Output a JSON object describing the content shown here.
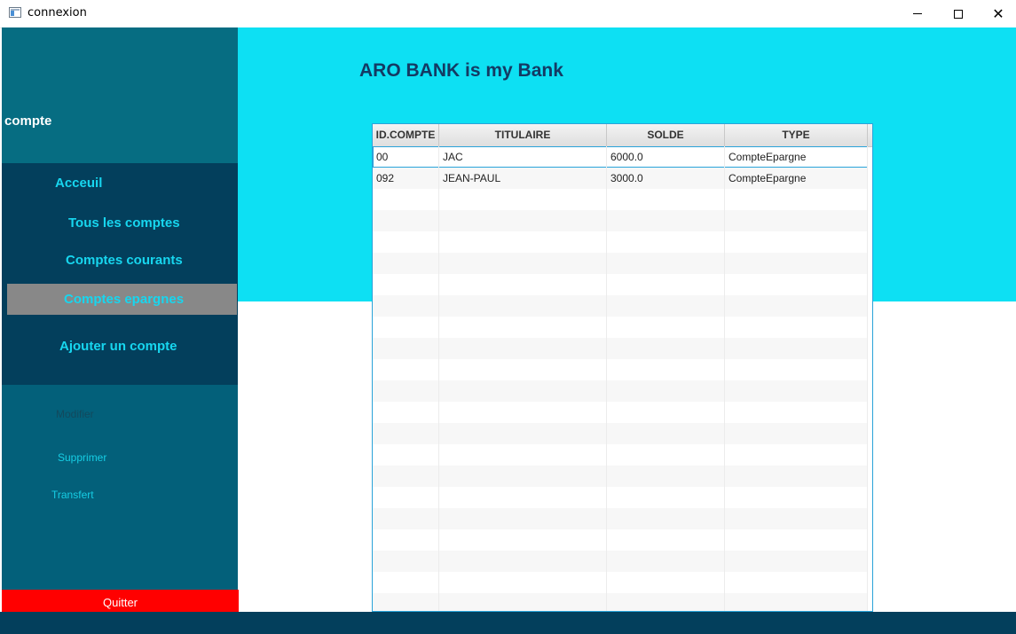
{
  "window": {
    "title": "connexion",
    "minimize_icon": "minimize-icon",
    "maximize_icon": "maximize-icon",
    "close_icon": "close-icon",
    "close_glyph": "✕"
  },
  "sidebar": {
    "heading": "compte",
    "nav": {
      "accueil": "Acceuil",
      "tous": "Tous les comptes",
      "courants": "Comptes courants",
      "epargnes": "Comptes epargnes",
      "ajouter": "Ajouter un compte"
    },
    "actions": {
      "modifier": "Modifier",
      "supprimer": "Supprimer",
      "transfert": "Transfert"
    },
    "quit": "Quitter"
  },
  "main": {
    "title": "ARO BANK is my Bank"
  },
  "table": {
    "columns": [
      "ID.COMPTE",
      "TITULAIRE",
      "SOLDE",
      "TYPE"
    ],
    "rows": [
      [
        "00",
        "JAC",
        "6000.0",
        "CompteEpargne"
      ],
      [
        "092",
        "JEAN-PAUL",
        "3000.0",
        "CompteEpargne"
      ]
    ],
    "selected_row": 0
  },
  "colors": {
    "banner": "#0de0f3",
    "sidebar": "#03607a",
    "nav_block": "#033f5c",
    "nav_text": "#17d6ef",
    "selected_nav": "#888888",
    "quit": "#ff0000"
  }
}
